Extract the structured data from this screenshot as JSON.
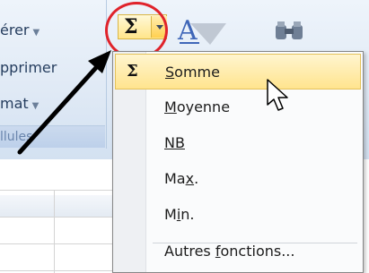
{
  "ribbon": {
    "items": [
      {
        "name": "inserer",
        "text": "érer",
        "caret": "▼"
      },
      {
        "name": "supprimer",
        "text": "pprimer",
        "caret": "▼"
      },
      {
        "name": "format",
        "text": "mat",
        "caret": "▼"
      }
    ],
    "group_label": "llules",
    "sum_button": {
      "symbol": "Σ"
    },
    "sort_icon": "sort-filter-icon",
    "find_icon": "find-binoculars-icon"
  },
  "menu": {
    "items": [
      {
        "name": "somme",
        "before": "",
        "accel": "S",
        "after": "omme",
        "icon": "Σ",
        "highlighted": true
      },
      {
        "name": "moyenne",
        "before": "",
        "accel": "M",
        "after": "oyenne"
      },
      {
        "name": "nb",
        "before": "",
        "accel": "NB",
        "after": ""
      },
      {
        "name": "max",
        "before": "Ma",
        "accel": "x",
        "after": "."
      },
      {
        "name": "min",
        "before": "M",
        "accel": "i",
        "after": "n."
      },
      {
        "name": "autres-fonctions",
        "before": "Autres ",
        "accel": "f",
        "after": "onctions..."
      }
    ]
  },
  "colors": {
    "highlight": "#ffe48e",
    "annotation_circle": "#e0232b",
    "annotation_arrow": "#000000"
  }
}
